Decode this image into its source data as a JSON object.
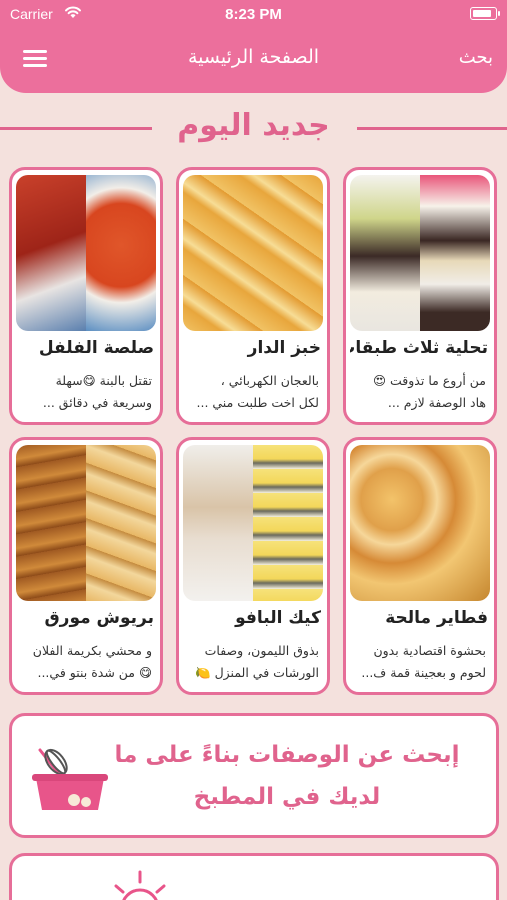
{
  "status_bar": {
    "carrier": "Carrier",
    "time": "8:23 PM",
    "battery_level": 0.9
  },
  "header": {
    "title": "الصفحة الرئيسية",
    "search_label": "بحث",
    "menu_icon": "hamburger-menu-icon"
  },
  "section": {
    "title": "جديد اليوم"
  },
  "recipes": [
    {
      "title": "صلصة الفلفل",
      "desc": [
        "تقتل بالبنة 😋سهلة",
        "وسريعة في دقائق ..."
      ]
    },
    {
      "title": "خبز الدار",
      "desc": [
        "بالعجان الكهربائي ،",
        "لكل اخت طلبت مني ..."
      ]
    },
    {
      "title": "تحلية ثلاث طبقات",
      "desc": [
        "من أروع ما تذوقت 😍",
        "هاد الوصفة لازم ..."
      ]
    },
    {
      "title": "بريوش مورق",
      "desc": [
        "و محشي بكريمة الفلان",
        "😋 من شدة بنتو في..."
      ]
    },
    {
      "title": "كيك البافو",
      "desc": [
        "بذوق الليمون، وصفات",
        "الورشات في المنزل 🍋"
      ]
    },
    {
      "title": "فطاير مالحة",
      "desc": [
        "بحشوة اقتصادية بدون",
        "لحوم و بعجينة قمة ف..."
      ]
    }
  ],
  "banner": {
    "line1": "إبحث عن الوصفات بناءً على ما",
    "line2": "لديك في المطبخ",
    "icon": "whisk-bowl-icon"
  },
  "colors": {
    "accent": "#ec6f9c",
    "border": "#e66e98",
    "background": "#f4e1dd"
  }
}
